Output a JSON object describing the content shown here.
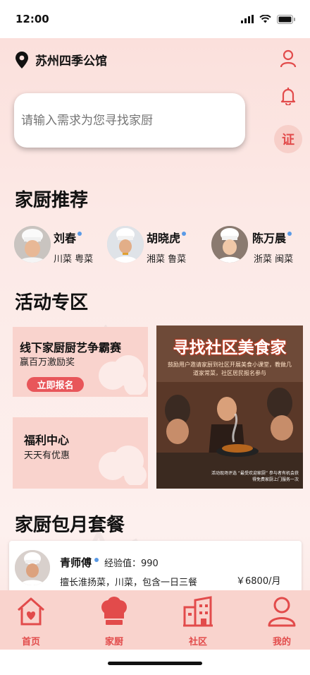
{
  "status": {
    "time": "12:00"
  },
  "header": {
    "location": "苏州四季公馆",
    "cert_label": "证"
  },
  "search": {
    "placeholder": "请输入需求为您寻找家厨"
  },
  "recommend": {
    "title": "家厨推荐",
    "chefs": [
      {
        "name": "刘春",
        "tags": "川菜 粤菜"
      },
      {
        "name": "胡晓虎",
        "tags": "湘菜 鲁菜"
      },
      {
        "name": "陈万晨",
        "tags": "浙菜 闽菜"
      }
    ]
  },
  "activity": {
    "title": "活动专区",
    "contest": {
      "title": "线下家厨厨艺争霸赛",
      "subtitle": "赢百万激励奖",
      "button": "立即报名"
    },
    "welfare": {
      "title": "福利中心",
      "subtitle": "天天有优惠"
    },
    "poster": {
      "title": "寻找社区美食家",
      "subtitle": "鼓励用户邀请家厨到社区开展美食小课堂，教做几道家常菜，社区居民报名参与",
      "footer": "活动现场评选 “最受欢迎家厨” 参与者有机会获得免费家厨上门服务一次"
    }
  },
  "monthly": {
    "title": "家厨包月套餐",
    "card": {
      "name": "青师傅",
      "experience": "经验值：990",
      "description": "擅长淮扬菜，川菜，包含一日三餐",
      "price": "￥6800/月"
    }
  },
  "tabs": [
    {
      "label": "首页",
      "icon": "home-icon"
    },
    {
      "label": "家厨",
      "icon": "chef-hat-icon"
    },
    {
      "label": "社区",
      "icon": "building-icon"
    },
    {
      "label": "我的",
      "icon": "user-icon"
    }
  ],
  "colors": {
    "accent": "#e24b4b",
    "background": "#fbe4e0",
    "card": "#f9d3cd"
  }
}
